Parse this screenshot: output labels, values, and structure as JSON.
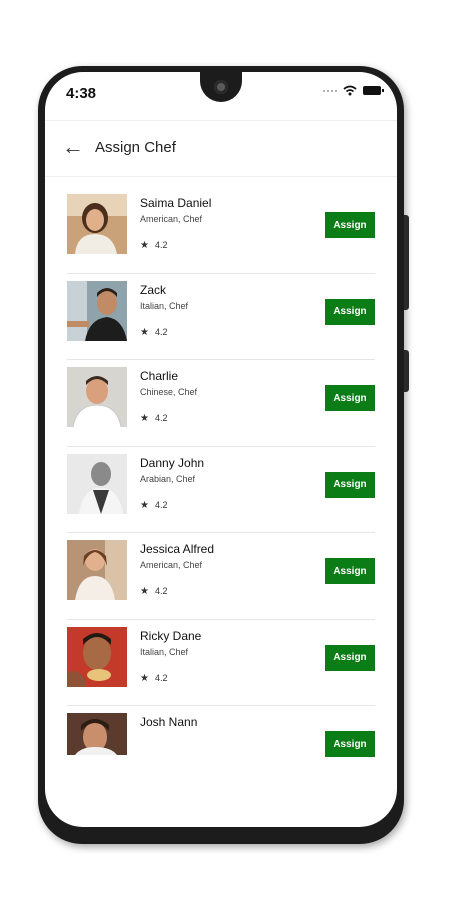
{
  "status": {
    "time": "4:38"
  },
  "header": {
    "title": "Assign Chef"
  },
  "chefs": [
    {
      "name": "Saima Daniel",
      "cuisine": "American, Chef",
      "rating": "4.2",
      "action": "Assign"
    },
    {
      "name": "Zack",
      "cuisine": "Italian, Chef",
      "rating": "4.2",
      "action": "Assign"
    },
    {
      "name": "Charlie",
      "cuisine": "Chinese, Chef",
      "rating": "4.2",
      "action": "Assign"
    },
    {
      "name": "Danny John",
      "cuisine": "Arabian, Chef",
      "rating": "4.2",
      "action": "Assign"
    },
    {
      "name": "Jessica Alfred",
      "cuisine": "American, Chef",
      "rating": "4.2",
      "action": "Assign"
    },
    {
      "name": "Ricky Dane",
      "cuisine": "Italian, Chef",
      "rating": "4.2",
      "action": "Assign"
    },
    {
      "name": "Josh Nann",
      "action": "Assign"
    }
  ],
  "colors": {
    "accent": "#0a7d16",
    "phone_frame": "#1c1c1c"
  },
  "icons": {
    "back": "arrow-left-icon",
    "rating": "star-icon",
    "signal": "wifi-icon",
    "battery": "battery-icon"
  }
}
